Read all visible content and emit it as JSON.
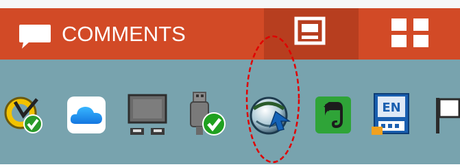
{
  "header": {
    "comments_label": "COMMENTS",
    "comments_icon": "speech-bubble-icon",
    "view_buttons": [
      {
        "icon": "single-view-icon",
        "active": true
      },
      {
        "icon": "grid-view-icon",
        "active": false
      }
    ],
    "colors": {
      "bar": "#d24a26",
      "active": "#b73e1f",
      "text": "#ffffff"
    }
  },
  "tray": {
    "background": "#78a3ae",
    "icons": [
      "norton-checkmark-icon",
      "icloud-icon",
      "network-monitor-icon",
      "usb-safe-remove-icon",
      "globe-arrow-icon",
      "evernote-icon",
      "keyboard-language-icon",
      "flag-icon"
    ],
    "highlighted_icon": "globe-arrow-icon",
    "annotation_color": "#e00000"
  }
}
